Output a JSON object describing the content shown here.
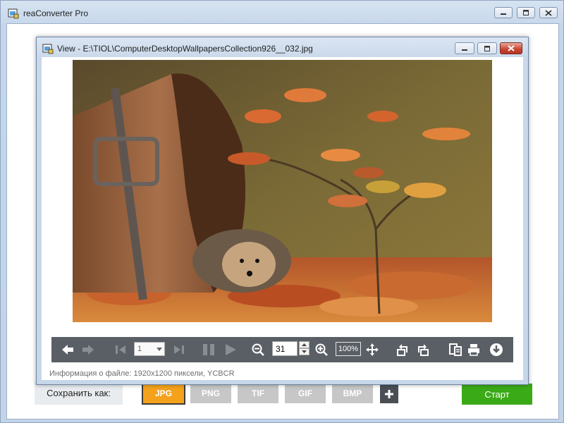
{
  "main": {
    "title": "reaConverter Pro",
    "save_as_label": "Сохранить как:",
    "formats": [
      "JPG",
      "PNG",
      "TIF",
      "GIF",
      "BMP"
    ],
    "active_format": "JPG",
    "add_label": "+",
    "start_label": "Старт"
  },
  "view": {
    "title": "View - E:\\TIOL\\ComputerDesktopWallpapersCollection926__032.jpg",
    "page_number": "1",
    "zoom_value": "31",
    "actual_size_label": "100%",
    "file_info": "Информация о файле: 1920x1200 пиксели, YCBCR"
  },
  "icons": {
    "back": "arrow-left-icon",
    "forward": "arrow-right-icon",
    "first": "first-page-icon",
    "last": "last-page-icon",
    "pause": "pause-icon",
    "play": "play-icon",
    "zoom_out": "zoom-out-icon",
    "zoom_in": "zoom-in-icon",
    "fit": "move-icon",
    "rotate_left": "rotate-left-icon",
    "rotate_right": "rotate-right-icon",
    "info": "file-info-icon",
    "print": "print-icon",
    "save": "download-icon"
  },
  "colors": {
    "active_format": "#f4a21c",
    "start": "#3aaa17",
    "toolbar": "#5a5f66"
  }
}
